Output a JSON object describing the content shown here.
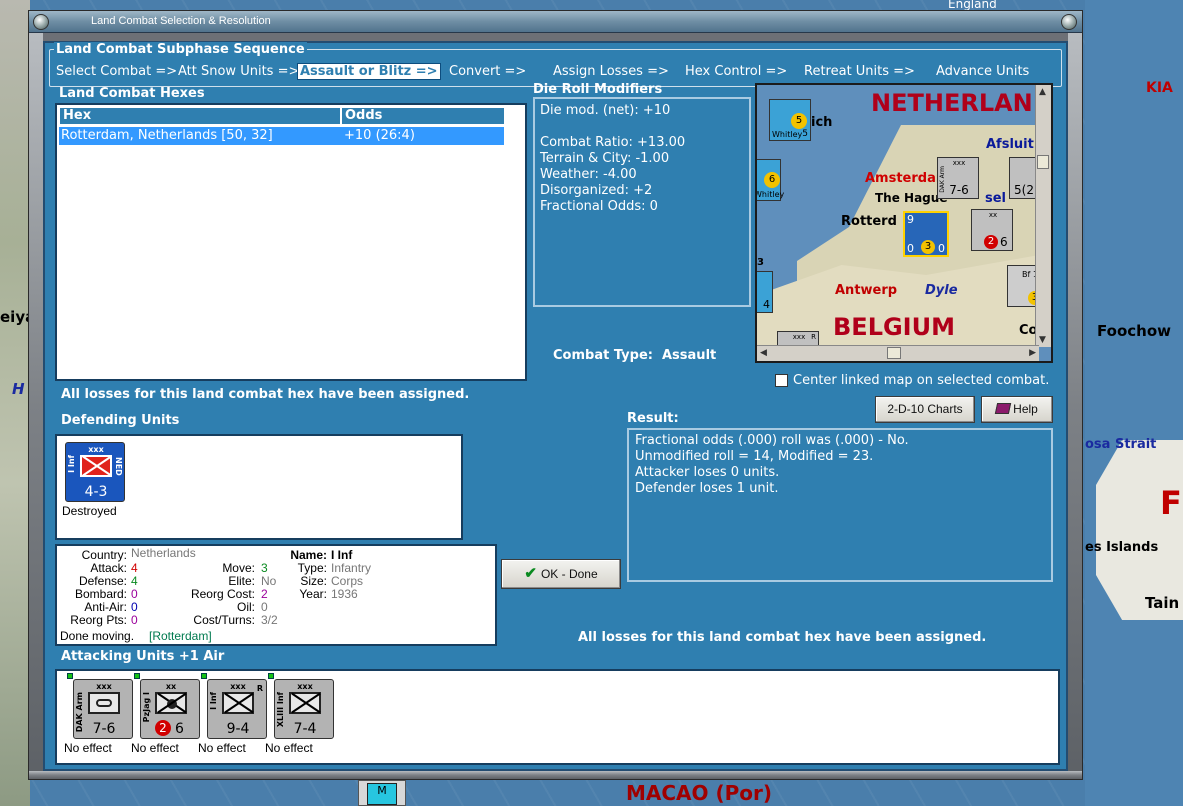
{
  "window": {
    "title": "Land Combat Selection & Resolution"
  },
  "background": {
    "england_label": "England",
    "kia_label": "KIA",
    "foochow_label": "Foochow",
    "formosa_label": "osa Strait",
    "islands_label": "es Islands",
    "tain_label": "Tain",
    "macao_label": "MACAO (Por)",
    "f_label": "F",
    "left_label": "eiya",
    "left_h": "H",
    "stack_label": "M"
  },
  "subphase": {
    "legend": "Land Combat Subphase Sequence",
    "phases": [
      {
        "label": "Select Combat =>"
      },
      {
        "label": "Att Snow Units =>"
      },
      {
        "label": "Assault or Blitz =>"
      },
      {
        "label": "Convert =>"
      },
      {
        "label": "Assign Losses =>"
      },
      {
        "label": "Hex Control =>"
      },
      {
        "label": "Retreat Units =>"
      },
      {
        "label": "Advance Units"
      }
    ],
    "active_index": 2
  },
  "hexes": {
    "title": "Land Combat Hexes",
    "columns": [
      "Hex",
      "Odds"
    ],
    "rows": [
      {
        "hex": "Rotterdam, Netherlands [50, 32]",
        "odds": "+10 (26:4)"
      }
    ]
  },
  "die_roll": {
    "title": "Die Roll Modifiers",
    "lines": [
      "Die mod. (net): +10",
      "",
      "Combat Ratio: +13.00",
      "Terrain & City: -1.00",
      "Weather: -4.00",
      "Disorganized: +2",
      "Fractional Odds: 0"
    ]
  },
  "mini_map": {
    "netherlands": "NETHERLAN",
    "belgium": "BELGIUM",
    "amsterdam": "Amsterdam",
    "the_hague": "The Hague",
    "rotterdam": "Rotterd",
    "antwerp": "Antwerp",
    "dyle": "Dyle",
    "afsluit": "Afsluit",
    "ich": "ich",
    "sel": "sel",
    "co": "Co",
    "top_counter_str": "7-6",
    "top_counter_label": "DAK Arm",
    "right_counter_str": "5(2",
    "pzjag_str": "6",
    "pzjag_badge": "2",
    "blue_stack_num": "9",
    "blue_stack_vals": [
      "0",
      "3",
      "0"
    ],
    "air1_num": "5",
    "air1_label": "Whitley",
    "air1_val": "5",
    "air2_num": "6",
    "air2_label": "Whitley",
    "bf_label": "Bf 10",
    "bf_num": "3",
    "left_num1": "3",
    "left_num2": "4",
    "xxx": "xxx",
    "xx": "xx",
    "r": "R"
  },
  "combat_type": {
    "label": "Combat Type:",
    "value": "Assault"
  },
  "center_map": {
    "label": "Center linked map on selected combat.",
    "checked": false
  },
  "buttons": {
    "charts": "2-D-10 Charts",
    "help": "Help",
    "done": "OK - Done"
  },
  "losses_msg_left": "All losses for this land combat hex have been assigned.",
  "losses_msg_right": "All losses for this land combat hex have been assigned.",
  "defending": {
    "title": "Defending Units",
    "units": [
      {
        "xxx": "xxx",
        "side": "I Inf",
        "side_r": "NED",
        "strength": "4-3",
        "status": "Destroyed"
      }
    ]
  },
  "info": {
    "country_k": "Country:",
    "country_v": "Netherlands",
    "attack_k": "Attack:",
    "attack_v": "4",
    "defense_k": "Defense:",
    "defense_v": "4",
    "bombard_k": "Bombard:",
    "bombard_v": "0",
    "antiair_k": "Anti-Air:",
    "antiair_v": "0",
    "reorgpts_k": "Reorg Pts:",
    "reorgpts_v": "0",
    "move_k": "Move:",
    "move_v": "3",
    "elite_k": "Elite:",
    "elite_v": "No",
    "reorgcost_k": "Reorg Cost:",
    "reorgcost_v": "2",
    "oil_k": "Oil:",
    "oil_v": "0",
    "costturns_k": "Cost/Turns:",
    "costturns_v": "3/2",
    "name_k": "Name:",
    "name_v": "I Inf",
    "type_k": "Type:",
    "type_v": "Infantry",
    "size_k": "Size:",
    "size_v": "Corps",
    "year_k": "Year:",
    "year_v": "1936",
    "status_prefix": "Done moving.",
    "status_loc": "[Rotterdam]"
  },
  "result": {
    "title": "Result:",
    "lines": [
      "Fractional odds (.000) roll was (.000)  - No.",
      "Unmodified roll = 14, Modified = 23.",
      "Attacker loses 0 units.",
      "Defender loses 1 unit."
    ]
  },
  "attacking": {
    "title": "Attacking Units +1 Air",
    "units": [
      {
        "xxx": "xxx",
        "side": "DAK Arm",
        "side_r": "",
        "strength": "7-6",
        "status": "No effect"
      },
      {
        "xxx": "xx",
        "side": "PzJag I",
        "side_r": "",
        "strength": "6",
        "badge": "2",
        "status": "No effect"
      },
      {
        "xxx": "xxx",
        "side": "I Inf",
        "side_r": "R",
        "strength": "9-4",
        "status": "No effect"
      },
      {
        "xxx": "xxx",
        "side": "XLIII Inf",
        "side_r": "",
        "strength": "7-4",
        "status": "No effect"
      }
    ]
  },
  "colors": {
    "panel_blue": "#2f7fb0",
    "highlight": "#3399ff"
  }
}
